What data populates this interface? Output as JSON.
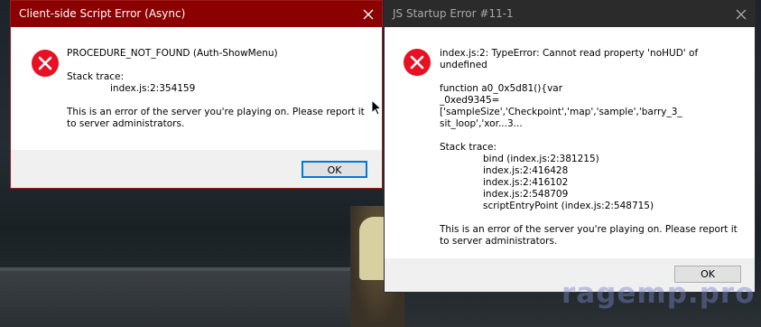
{
  "dialogs": [
    {
      "title": "Client-side Script Error (Async)",
      "lines": [
        "PROCEDURE_NOT_FOUND (Auth-ShowMenu)",
        "",
        "Stack trace:",
        "index.js:2:354159",
        "",
        "This is an error of the server you're playing on. Please report it",
        "to server administrators."
      ],
      "ok_label": "OK"
    },
    {
      "title": "JS Startup Error #11-1",
      "lines": [
        "index.js:2: TypeError: Cannot read property 'noHUD' of",
        "undefined",
        "",
        "function a0_0x5d81(){var",
        "_0xed9345=['sampleSize','Checkpoint','map','sample','barry_3_",
        "sit_loop','xor...3...",
        "",
        "Stack trace:",
        "bind (index.js:2:381215)",
        "index.js:2:416428",
        "index.js:2:416102",
        "index.js:2:548709",
        "scriptEntryPoint (index.js:2:548715)",
        "",
        "This is an error of the server you're playing on. Please report it",
        "to server administrators."
      ],
      "ok_label": "OK"
    }
  ],
  "watermark": "ragemp.pro",
  "colors": {
    "left_titlebar": "#8b0000",
    "right_titlebar": "#2b2b2b",
    "error_icon": "#e81123",
    "focus_border": "#0078d7"
  },
  "icons": [
    "error-icon",
    "close-icon",
    "mouse-cursor-icon"
  ]
}
